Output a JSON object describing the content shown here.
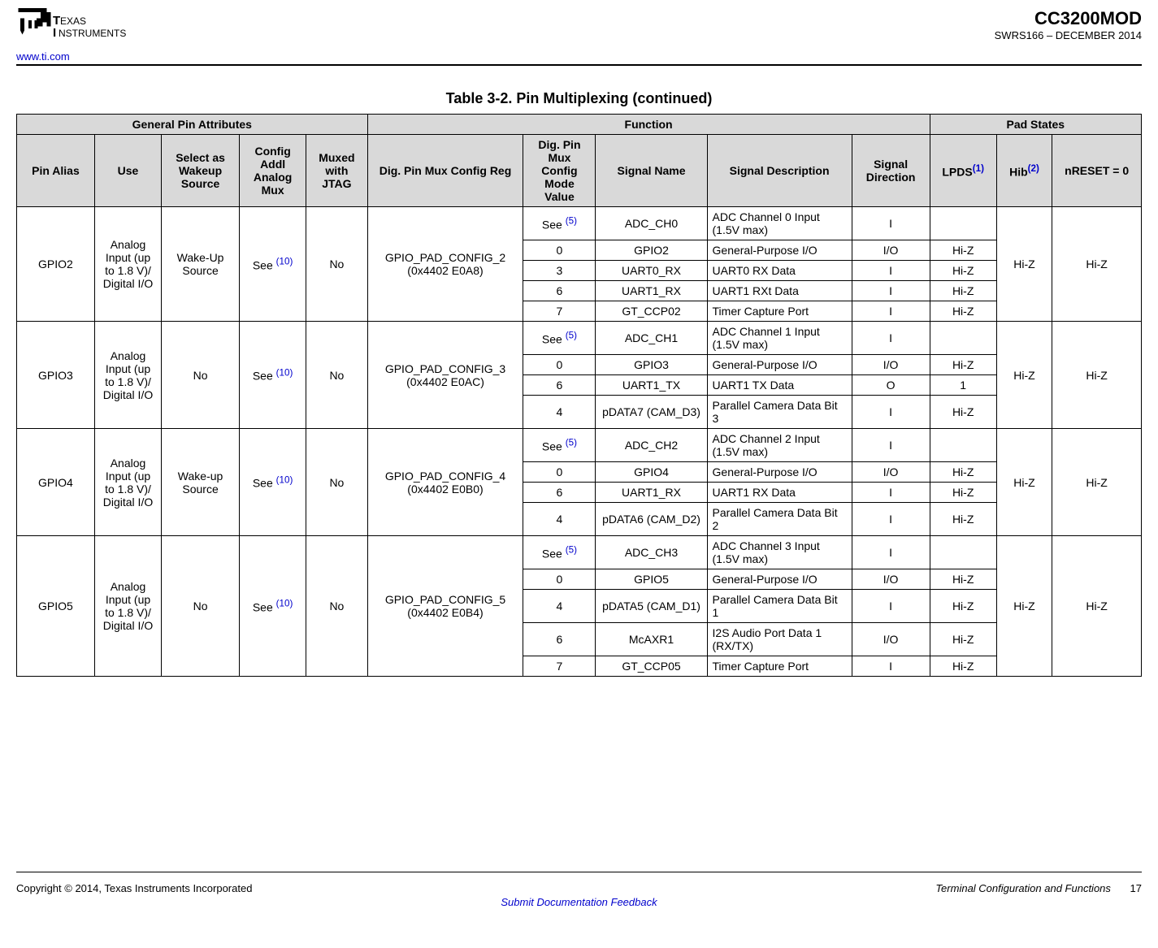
{
  "header": {
    "site_url": "www.ti.com",
    "part_number": "CC3200MOD",
    "doc_rev": "SWRS166 – DECEMBER 2014"
  },
  "table": {
    "caption": "Table 3-2. Pin Multiplexing (continued)",
    "group_headers": {
      "general": "General Pin Attributes",
      "function": "Function",
      "pad": "Pad States"
    },
    "columns": {
      "pin_alias": "Pin Alias",
      "use": "Use",
      "wakeup": "Select as Wakeup Source",
      "analog_mux": "Config Addl Analog Mux",
      "jtag": "Muxed with JTAG",
      "mux_reg": "Dig. Pin Mux Config Reg",
      "mux_mode": "Dig. Pin Mux Config Mode Value",
      "signal_name": "Signal Name",
      "signal_desc": "Signal Description",
      "signal_dir": "Signal Direction",
      "lpds_label": "LPDS",
      "lpds_sup": "(1)",
      "hib_label": "Hib",
      "hib_sup": "(2)",
      "nreset": "nRESET = 0"
    },
    "see_prefix": "See ",
    "see5_sup": "(5)",
    "see10_sup": "(10)",
    "groups": [
      {
        "pin_alias": "GPIO2",
        "use": "Analog Input (up to 1.8 V)/ Digital I/O",
        "wakeup": "Wake-Up Source",
        "jtag": "No",
        "mux_reg": "GPIO_PAD_CONFIG_2 (0x4402 E0A8)",
        "hib": "Hi-Z",
        "nreset": "Hi-Z",
        "rows": [
          {
            "mode": "see5",
            "name": "ADC_CH0",
            "desc": "ADC Channel 0 Input (1.5V max)",
            "dir": "I",
            "lpds": ""
          },
          {
            "mode": "0",
            "name": "GPIO2",
            "desc": "General-Purpose I/O",
            "dir": "I/O",
            "lpds": "Hi-Z"
          },
          {
            "mode": "3",
            "name": "UART0_RX",
            "desc": "UART0 RX Data",
            "dir": "I",
            "lpds": "Hi-Z"
          },
          {
            "mode": "6",
            "name": "UART1_RX",
            "desc": "UART1 RXt Data",
            "dir": "I",
            "lpds": "Hi-Z"
          },
          {
            "mode": "7",
            "name": "GT_CCP02",
            "desc": "Timer Capture Port",
            "dir": "I",
            "lpds": "Hi-Z"
          }
        ]
      },
      {
        "pin_alias": "GPIO3",
        "use": "Analog Input (up to 1.8 V)/ Digital I/O",
        "wakeup": "No",
        "jtag": "No",
        "mux_reg": "GPIO_PAD_CONFIG_3 (0x4402 E0AC)",
        "hib": "Hi-Z",
        "nreset": "Hi-Z",
        "rows": [
          {
            "mode": "see5",
            "name": "ADC_CH1",
            "desc": "ADC Channel 1 Input (1.5V max)",
            "dir": "I",
            "lpds": ""
          },
          {
            "mode": "0",
            "name": "GPIO3",
            "desc": "General-Purpose I/O",
            "dir": "I/O",
            "lpds": "Hi-Z"
          },
          {
            "mode": "6",
            "name": "UART1_TX",
            "desc": "UART1 TX Data",
            "dir": "O",
            "lpds": "1"
          },
          {
            "mode": "4",
            "name": "pDATA7 (CAM_D3)",
            "desc": "Parallel Camera Data Bit 3",
            "dir": "I",
            "lpds": "Hi-Z"
          }
        ]
      },
      {
        "pin_alias": "GPIO4",
        "use": "Analog Input (up to 1.8 V)/ Digital I/O",
        "wakeup": "Wake-up Source",
        "jtag": "No",
        "mux_reg": "GPIO_PAD_CONFIG_4 (0x4402 E0B0)",
        "hib": "Hi-Z",
        "nreset": "Hi-Z",
        "rows": [
          {
            "mode": "see5",
            "name": "ADC_CH2",
            "desc": "ADC Channel 2 Input (1.5V max)",
            "dir": "I",
            "lpds": ""
          },
          {
            "mode": "0",
            "name": "GPIO4",
            "desc": "General-Purpose I/O",
            "dir": "I/O",
            "lpds": "Hi-Z"
          },
          {
            "mode": "6",
            "name": "UART1_RX",
            "desc": "UART1 RX Data",
            "dir": "I",
            "lpds": "Hi-Z"
          },
          {
            "mode": "4",
            "name": "pDATA6 (CAM_D2)",
            "desc": "Parallel Camera Data Bit 2",
            "dir": "I",
            "lpds": "Hi-Z"
          }
        ]
      },
      {
        "pin_alias": "GPIO5",
        "use": "Analog Input (up to 1.8 V)/ Digital I/O",
        "wakeup": "No",
        "jtag": "No",
        "mux_reg": "GPIO_PAD_CONFIG_5 (0x4402 E0B4)",
        "hib": "Hi-Z",
        "nreset": "Hi-Z",
        "rows": [
          {
            "mode": "see5",
            "name": "ADC_CH3",
            "desc": "ADC Channel 3 Input (1.5V max)",
            "dir": "I",
            "lpds": ""
          },
          {
            "mode": "0",
            "name": "GPIO5",
            "desc": "General-Purpose I/O",
            "dir": "I/O",
            "lpds": "Hi-Z"
          },
          {
            "mode": "4",
            "name": "pDATA5 (CAM_D1)",
            "desc": "Parallel Camera Data Bit 1",
            "dir": "I",
            "lpds": "Hi-Z"
          },
          {
            "mode": "6",
            "name": "McAXR1",
            "desc": "I2S Audio Port Data 1 (RX/TX)",
            "dir": "I/O",
            "lpds": "Hi-Z"
          },
          {
            "mode": "7",
            "name": "GT_CCP05",
            "desc": "Timer Capture Port",
            "dir": "I",
            "lpds": "Hi-Z"
          }
        ]
      }
    ]
  },
  "footer": {
    "copyright": "Copyright © 2014, Texas Instruments Incorporated",
    "section": "Terminal Configuration and Functions",
    "page_number": "17",
    "feedback": "Submit Documentation Feedback"
  }
}
